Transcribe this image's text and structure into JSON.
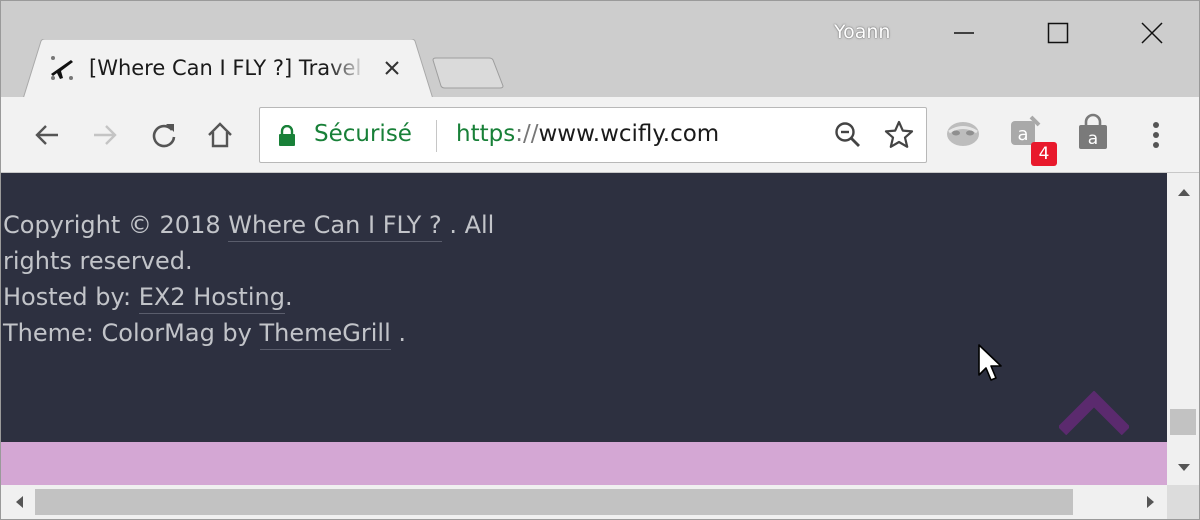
{
  "window": {
    "user": "Yoann"
  },
  "tab": {
    "title": "[Where Can I FLY ?] Travel",
    "favicon": "airplane-icon"
  },
  "toolbar": {
    "security_label": "Sécurisé",
    "url_scheme": "https",
    "url_separator": "://",
    "url_host": "www.wcifly.com",
    "extension_badge": "4"
  },
  "footer": {
    "copyright_prefix": "Copyright © 2018 ",
    "site_link": "Where Can I FLY ?",
    "copyright_suffix": " . All rights reserved.",
    "hosted_prefix": "Hosted by: ",
    "hosting_link": "EX2 Hosting",
    "hosted_suffix": ".",
    "theme_prefix": "Theme: ColorMag by ",
    "theme_link": "ThemeGrill",
    "theme_suffix": " ."
  },
  "colors": {
    "footer_bg": "#2d3040",
    "footer_text": "#c2c4c9",
    "accent_band": "#d4a7d4",
    "scroll_top_arrow": "#5b2a6e",
    "secure_green": "#188038"
  }
}
